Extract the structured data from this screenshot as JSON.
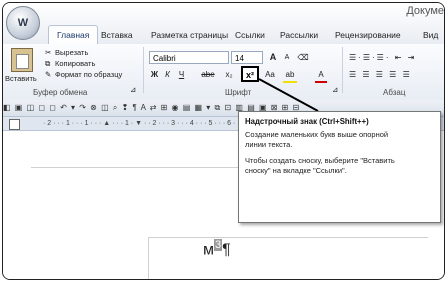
{
  "window": {
    "title": "Докуме"
  },
  "office_button": {
    "glyph": "W"
  },
  "tabs": [
    {
      "label": "Главная",
      "active": true
    },
    {
      "label": "Вставка"
    },
    {
      "label": "Разметка страницы"
    },
    {
      "label": "Ссылки"
    },
    {
      "label": "Рассылки"
    },
    {
      "label": "Рецензирование"
    },
    {
      "label": "Вид"
    }
  ],
  "clipboard": {
    "paste_label": "Вставить",
    "cut_label": "Вырезать",
    "copy_label": "Копировать",
    "format_painter_label": "Формат по образцу",
    "group_label": "Буфер обмена"
  },
  "font": {
    "name": "Calibri",
    "size": "14",
    "grow": "A",
    "shrink": "A",
    "bold": "Ж",
    "italic": "К",
    "underline": "Ч",
    "strike": "abe",
    "subscript": "x₂",
    "superscript": "x²",
    "case": "Aa",
    "highlight": "ab",
    "color": "A",
    "group_label": "Шрифт"
  },
  "paragraph": {
    "group_label": "Абзац"
  },
  "qat": {
    "icons": "◧ ▣ ◫ ◻ ◻ ↶ ▾ ↷ ⊗ ◫ ⌕ ❢ ¶ A ⇄ ⊞ ◉ ▤ ▦ ▾ ⧉ ⊡ ▥ ▤ ▣ ⊠ ⊞ ⊟"
  },
  "ruler": {
    "text": "· 2 · · · 1 · · · 1 · · · ▲ · · · 1 · ▼ · · 2 · · · 3 · · · 4 · · · 5 · · · 6 · · · 7"
  },
  "document": {
    "text_base": "м",
    "text_sup": "3",
    "mark": "¶"
  },
  "tooltip": {
    "title": "Надстрочный знак (Ctrl+Shift++)",
    "p1": "Создание маленьких букв выше опорной\nлинии текста.",
    "p2": "Чтобы создать сноску, выберите \"Вставить\nсноску\" на вкладке \"Ссылки\"."
  }
}
